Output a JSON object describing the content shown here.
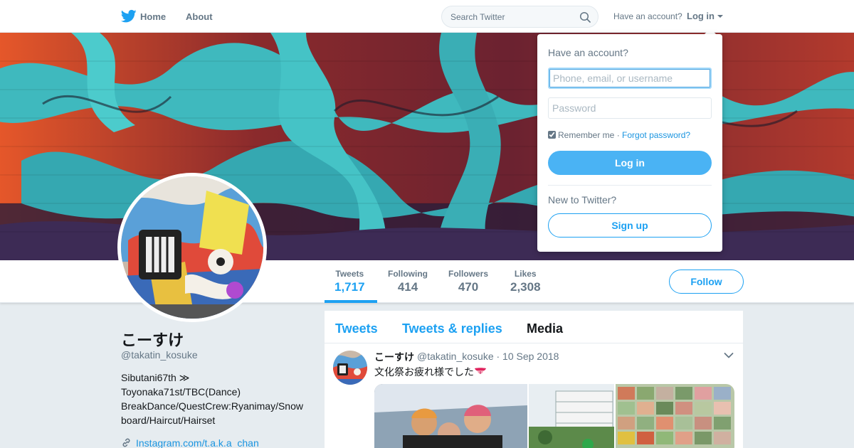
{
  "colors": {
    "accent": "#1da1f2",
    "text": "#14171a",
    "muted": "#657786",
    "background": "#e6ecf0",
    "button": "#4ab3f4"
  },
  "nav": {
    "home": "Home",
    "about": "About",
    "search_placeholder": "Search Twitter",
    "have_account": "Have an account?",
    "login": "Log in"
  },
  "login_dropdown": {
    "title": "Have an account?",
    "username_placeholder": "Phone, email, or username",
    "password_placeholder": "Password",
    "remember_me": "Remember me",
    "separator": "·",
    "forgot_password": "Forgot password?",
    "login_button": "Log in",
    "new_to_twitter": "New to Twitter?",
    "signup_button": "Sign up"
  },
  "profile": {
    "name": "こーすけ",
    "handle": "@takatin_kosuke",
    "bio": "Sibutani67th ≫ Toyonaka71st/TBC(Dance) BreakDance/QuestCrew:Ryanimay/Snowboard/Haircut/Hairset",
    "link": "Instagram.com/t.a.k.a_chan"
  },
  "stats": [
    {
      "label": "Tweets",
      "value": "1,717"
    },
    {
      "label": "Following",
      "value": "414"
    },
    {
      "label": "Followers",
      "value": "470"
    },
    {
      "label": "Likes",
      "value": "2,308"
    }
  ],
  "follow_button": "Follow",
  "timeline_tabs": [
    "Tweets",
    "Tweets & replies",
    "Media"
  ],
  "tweet": {
    "name": "こーすけ",
    "handle_date": "@takatin_kosuke · 10 Sep 2018",
    "text": "文化祭お疲れ様でした"
  },
  "icons": {
    "logo": "twitter-bird-icon",
    "search": "search-icon",
    "caret": "caret-down-icon",
    "link": "link-icon",
    "tweet_menu": "chevron-down-icon",
    "emoji": "tongue-emoji-icon"
  }
}
